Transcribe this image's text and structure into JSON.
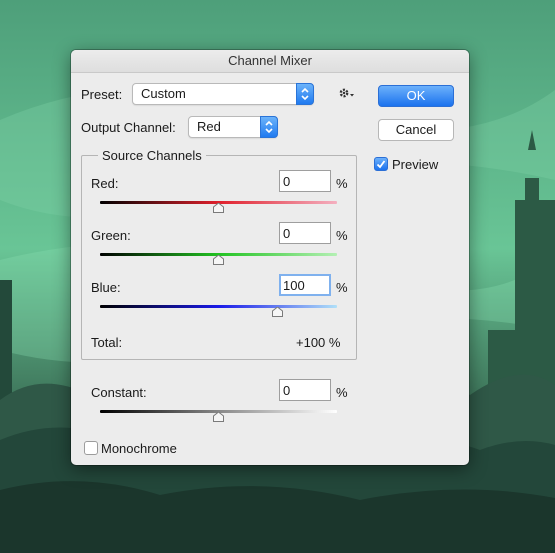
{
  "dialog": {
    "title": "Channel Mixer",
    "preset_label": "Preset:",
    "preset_value": "Custom",
    "gear_icon": "gear-icon",
    "output_channel_label": "Output Channel:",
    "output_channel_value": "Red",
    "ok_label": "OK",
    "cancel_label": "Cancel",
    "preview_label": "Preview",
    "preview_checked": true,
    "source_channels_title": "Source Channels",
    "channels": [
      {
        "label": "Red:",
        "value": "0",
        "unit": "%",
        "slider_fraction": 0.5,
        "gradient": [
          "#000000",
          "#e0202c",
          "#f4b0c0"
        ]
      },
      {
        "label": "Green:",
        "value": "0",
        "unit": "%",
        "slider_fraction": 0.5,
        "gradient": [
          "#000000",
          "#22c322",
          "#b4f0b4"
        ]
      },
      {
        "label": "Blue:",
        "value": "100",
        "unit": "%",
        "slider_fraction": 0.75,
        "gradient": [
          "#000000",
          "#1a1ae8",
          "#b0e0f8"
        ]
      }
    ],
    "total_label": "Total:",
    "total_value": "+100 %",
    "constant": {
      "label": "Constant:",
      "value": "0",
      "unit": "%",
      "slider_fraction": 0.5,
      "gradient": [
        "#000000",
        "#888888",
        "#ffffff"
      ]
    },
    "monochrome_label": "Monochrome",
    "monochrome_checked": false
  },
  "colors": {
    "accent": "#1b72ee",
    "dialog_bg": "#ececec",
    "background_tint": "#4fa07a"
  }
}
